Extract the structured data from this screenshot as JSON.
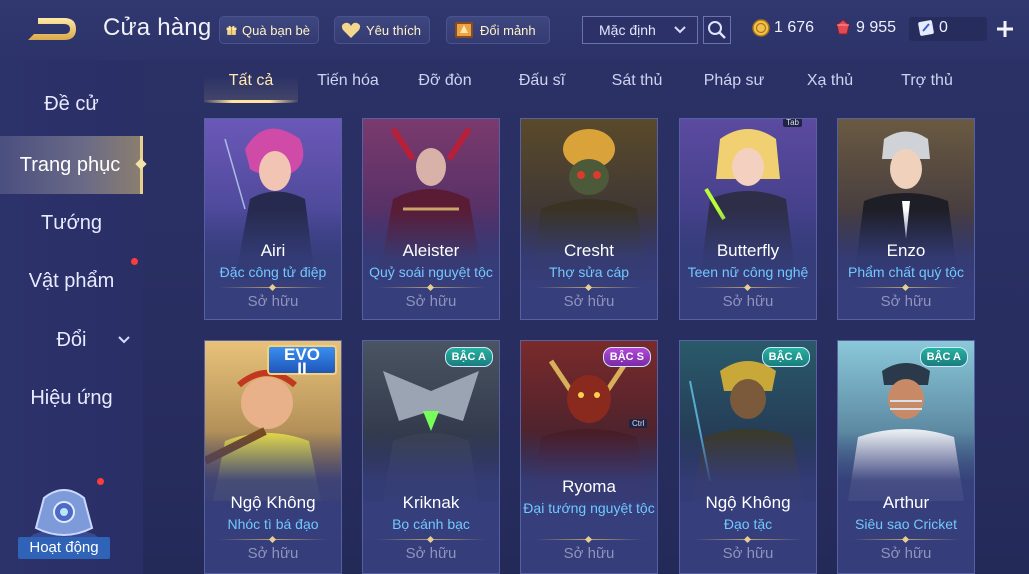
{
  "header": {
    "title": "Cửa hàng",
    "buttons": [
      {
        "label": "Quà bạn bè",
        "icon": "gift-icon"
      },
      {
        "label": "Yêu thích",
        "icon": "heart-icon"
      },
      {
        "label": "Đổi mảnh",
        "icon": "shard-icon"
      }
    ],
    "sort": {
      "value": "Mặc định"
    },
    "currencies": [
      {
        "icon": "gold-coin-icon",
        "value": "1 676"
      },
      {
        "icon": "ruby-gem-icon",
        "value": "9 955"
      },
      {
        "icon": "ticket-icon",
        "value": "0"
      }
    ]
  },
  "sidebar": {
    "items": [
      {
        "label": "Đề cử"
      },
      {
        "label": "Trang phục"
      },
      {
        "label": "Tướng"
      },
      {
        "label": "Vật phẩm"
      },
      {
        "label": "Đổi"
      },
      {
        "label": "Hiệu ứng"
      }
    ],
    "event_label": "Hoạt động"
  },
  "tabs": [
    {
      "label": "Tất cả"
    },
    {
      "label": "Tiến hóa"
    },
    {
      "label": "Đỡ đòn"
    },
    {
      "label": "Đấu sĩ"
    },
    {
      "label": "Sát thủ"
    },
    {
      "label": "Pháp sư"
    },
    {
      "label": "Xạ thủ"
    },
    {
      "label": "Trợ thủ"
    }
  ],
  "cards": [
    {
      "hero": "Airi",
      "skin": "Đặc công tử điệp",
      "status": "Sở hữu",
      "badge": ""
    },
    {
      "hero": "Aleister",
      "skin": "Quỷ soái nguyệt tộc",
      "status": "Sở hữu",
      "badge": ""
    },
    {
      "hero": "Cresht",
      "skin": "Thợ sửa cáp",
      "status": "Sở hữu",
      "badge": ""
    },
    {
      "hero": "Butterfly",
      "skin": "Teen nữ công nghệ",
      "status": "Sở hữu",
      "badge": "",
      "tag": "Tab"
    },
    {
      "hero": "Enzo",
      "skin": "Phẩm chất quý tộc",
      "status": "Sở hữu",
      "badge": ""
    },
    {
      "hero": "Ngộ Không",
      "skin": "Nhóc tì bá đạo",
      "status": "Sở hữu",
      "badge": "EVO II"
    },
    {
      "hero": "Kriknak",
      "skin": "Bọ cánh bạc",
      "status": "Sở hữu",
      "badge": "BẬC A"
    },
    {
      "hero": "Ryoma",
      "skin": "Đại tướng nguyệt tộc",
      "status": "Sở hữu",
      "badge": "BẬC S",
      "tag": "Ctrl"
    },
    {
      "hero": "Ngộ Không",
      "skin": "Đạo tặc",
      "status": "Sở hữu",
      "badge": "BẬC A"
    },
    {
      "hero": "Arthur",
      "skin": "Siêu sao Cricket",
      "status": "Sở hữu",
      "badge": "BẬC A"
    }
  ],
  "colors": {
    "background": "#2a2f63",
    "accent_gold": "#ffe3a0",
    "skin_name_blue": "#72c8ff",
    "notification_red": "#ff3b3b"
  }
}
